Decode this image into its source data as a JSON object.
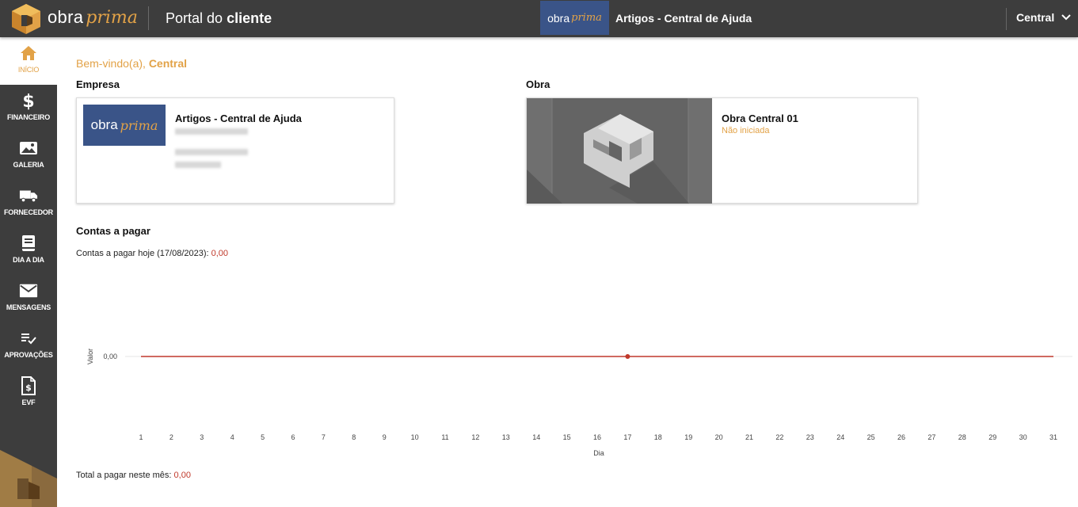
{
  "topbar": {
    "brand_word1": "obra",
    "brand_word2": "prima",
    "portal_prefix": "Portal do",
    "portal_strong": "cliente",
    "company_thumb_word1": "obra",
    "company_thumb_word2": "prima",
    "company_name": "Artigos - Central de Ajuda",
    "user_name": "Central",
    "user_menu_icon": "chevron-down-icon"
  },
  "sidebar": {
    "items": [
      {
        "label": "INÍCIO",
        "icon": "home-icon",
        "active": true
      },
      {
        "label": "FINANCEIRO",
        "icon": "dollar-icon",
        "active": false
      },
      {
        "label": "GALERIA",
        "icon": "image-icon",
        "active": false
      },
      {
        "label": "FORNECEDOR",
        "icon": "truck-icon",
        "active": false
      },
      {
        "label": "DIA A DIA",
        "icon": "book-icon",
        "active": false
      },
      {
        "label": "MENSAGENS",
        "icon": "mail-icon",
        "active": false
      },
      {
        "label": "APROVAÇÕES",
        "icon": "checklist-icon",
        "active": false
      },
      {
        "label": "EVF",
        "icon": "dollar-document-icon",
        "active": false
      }
    ]
  },
  "welcome": {
    "prefix": "Bem-vindo(a),",
    "name": "Central"
  },
  "empresa": {
    "section_title": "Empresa",
    "logo_word1": "obra",
    "logo_word2": "prima",
    "name": "Artigos - Central de Ajuda"
  },
  "obra": {
    "section_title": "Obra",
    "name": "Obra Central 01",
    "status": "Não iniciada"
  },
  "contas": {
    "section_title": "Contas a pagar",
    "today_label": "Contas a pagar hoje (17/08/2023):",
    "today_value": "0,00",
    "month_label": "Total a pagar neste mês:",
    "month_value": "0,00"
  },
  "colors": {
    "accent": "#e2a247",
    "topbar": "#3d3d3d",
    "line": "#c0392b"
  },
  "chart_data": {
    "type": "line",
    "xlabel": "Dia",
    "ylabel": "Valor",
    "x": [
      1,
      2,
      3,
      4,
      5,
      6,
      7,
      8,
      9,
      10,
      11,
      12,
      13,
      14,
      15,
      16,
      17,
      18,
      19,
      20,
      21,
      22,
      23,
      24,
      25,
      26,
      27,
      28,
      29,
      30,
      31
    ],
    "series": [
      {
        "values": [
          0,
          0,
          0,
          0,
          0,
          0,
          0,
          0,
          0,
          0,
          0,
          0,
          0,
          0,
          0,
          0,
          0,
          0,
          0,
          0,
          0,
          0,
          0,
          0,
          0,
          0,
          0,
          0,
          0,
          0,
          0
        ]
      }
    ],
    "y_tick_labels": [
      "0,00"
    ],
    "highlight_point": {
      "x": 17,
      "y": 0
    },
    "grid": false
  }
}
